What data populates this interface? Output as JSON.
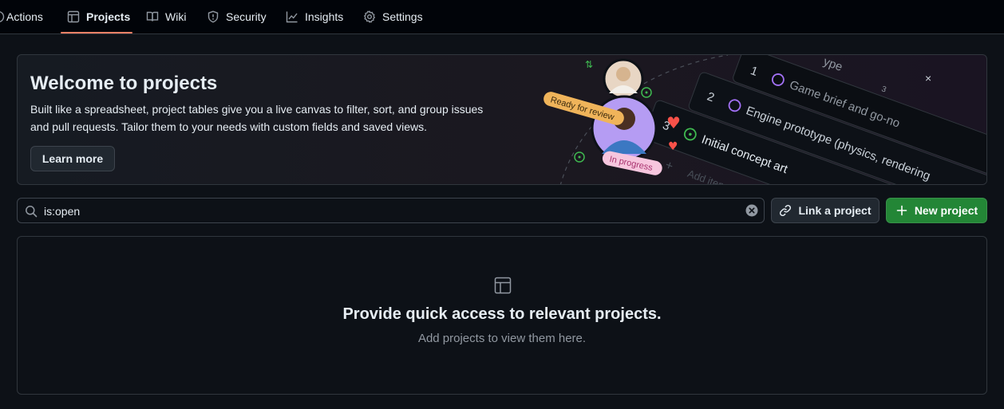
{
  "nav": {
    "tabs": [
      {
        "label": "Actions",
        "icon": "play-icon"
      },
      {
        "label": "Projects",
        "icon": "table-icon",
        "active": true
      },
      {
        "label": "Wiki",
        "icon": "book-icon"
      },
      {
        "label": "Security",
        "icon": "shield-icon"
      },
      {
        "label": "Insights",
        "icon": "graph-icon"
      },
      {
        "label": "Settings",
        "icon": "gear-icon"
      }
    ],
    "active_color": "#f78166"
  },
  "banner": {
    "title": "Welcome to projects",
    "description": "Built like a spreadsheet, project tables give you a live canvas to filter, sort, and group issues and pull requests. Tailor them to your needs with custom fields and saved views.",
    "button": "Learn more",
    "illustration": {
      "tag_ready": "Ready for review",
      "tag_progress": "In progress",
      "rows": [
        {
          "num": "1",
          "text": "Game brief and go-no",
          "extra": "ype",
          "count": "3"
        },
        {
          "num": "2",
          "text": "Engine prototype (physics, rendering"
        },
        {
          "num": "3",
          "text": "Initial concept art"
        }
      ],
      "add_item": "Add item"
    }
  },
  "search": {
    "value": "is:open"
  },
  "actions": {
    "link_project": "Link a project",
    "new_project": "New project"
  },
  "empty_state": {
    "title": "Provide quick access to relevant projects.",
    "subtitle": "Add projects to view them here."
  },
  "colors": {
    "background": "#0d1117",
    "primary_button": "#238636",
    "border": "#30363d",
    "muted_text": "#9198a1"
  }
}
